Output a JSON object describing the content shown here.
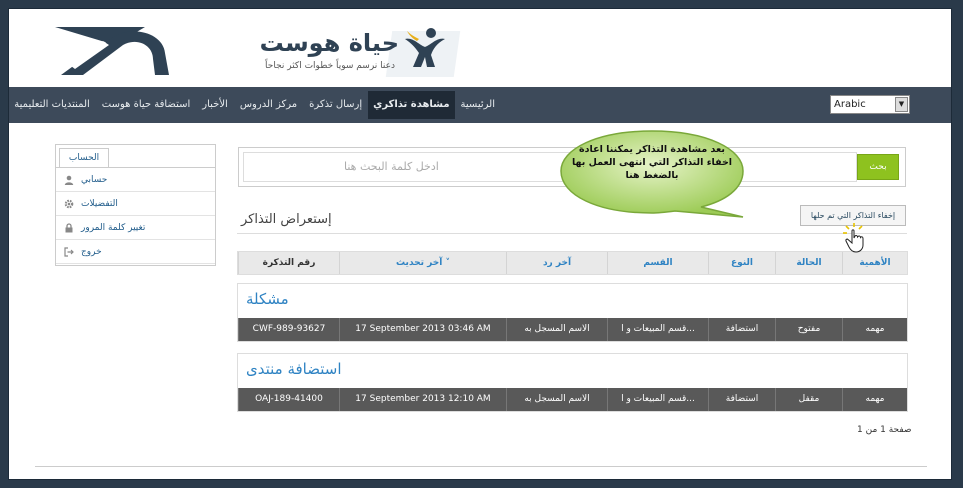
{
  "header": {
    "brand_name": "حياة هوست",
    "brand_tagline": "دعنا نرسم سوياً خطوات اكثر نجاحاً"
  },
  "nav": {
    "items": [
      "الرئيسية",
      "مشاهدة تذاكري",
      "إرسال تذكرة",
      "مركز الدروس",
      "الأخبار",
      "استضافة حياة هوست",
      "المنتديات التعليمية"
    ],
    "active_index": 1,
    "language": "Arabic"
  },
  "sidebar": {
    "tab": "الحساب",
    "items": [
      {
        "label": "حسابي",
        "icon": "user-icon"
      },
      {
        "label": "التفضيلات",
        "icon": "gear-icon"
      },
      {
        "label": "تغيير كلمة المرور",
        "icon": "lock-icon"
      },
      {
        "label": "خروج",
        "icon": "logout-icon"
      }
    ]
  },
  "search": {
    "placeholder": "ادخل كلمة البحث هنا",
    "button": "بحث"
  },
  "tickets": {
    "title": "إستعراض التذاكر",
    "hide_button": "إخفاء التذاكر التي تم حلها",
    "columns": {
      "priority": "الأهمية",
      "status": "الحالة",
      "type": "النوع",
      "department": "القسم",
      "last_reply": "آخر رد",
      "last_update": "آخر تحديث",
      "ticket_id": "رقم التذكرة"
    },
    "sort_indicator": "˅",
    "groups": [
      {
        "title": "مشكلة",
        "rows": [
          {
            "priority": "مهمه",
            "status": "مفتوح",
            "type": "استضافة",
            "department": "قسم المبيعات و ا...",
            "last_reply": "الاسم المسجل به",
            "last_update": "17 September 2013 03:46 AM",
            "ticket_id": "CWF-989-93627"
          }
        ]
      },
      {
        "title": "استضافة منتدى",
        "rows": [
          {
            "priority": "مهمه",
            "status": "مقفل",
            "type": "استضافة",
            "department": "قسم المبيعات و ا...",
            "last_reply": "الاسم المسجل به",
            "last_update": "17 September 2013 12:10 AM",
            "ticket_id": "OAJ-189-41400"
          }
        ]
      }
    ],
    "pager": "صفحة 1 من 1"
  },
  "callout": {
    "text": "بعد مشاهدة التذاكر يمكننا اعادة اخفاء التذاكر التي انتهى العمل بها بالضغط هنا"
  },
  "colors": {
    "nav_bg": "#3d4a5a",
    "search_button": "#8ec21f",
    "link_blue": "#2f83c3",
    "row_bg": "#595959",
    "bubble_green": "#a9d26a"
  }
}
